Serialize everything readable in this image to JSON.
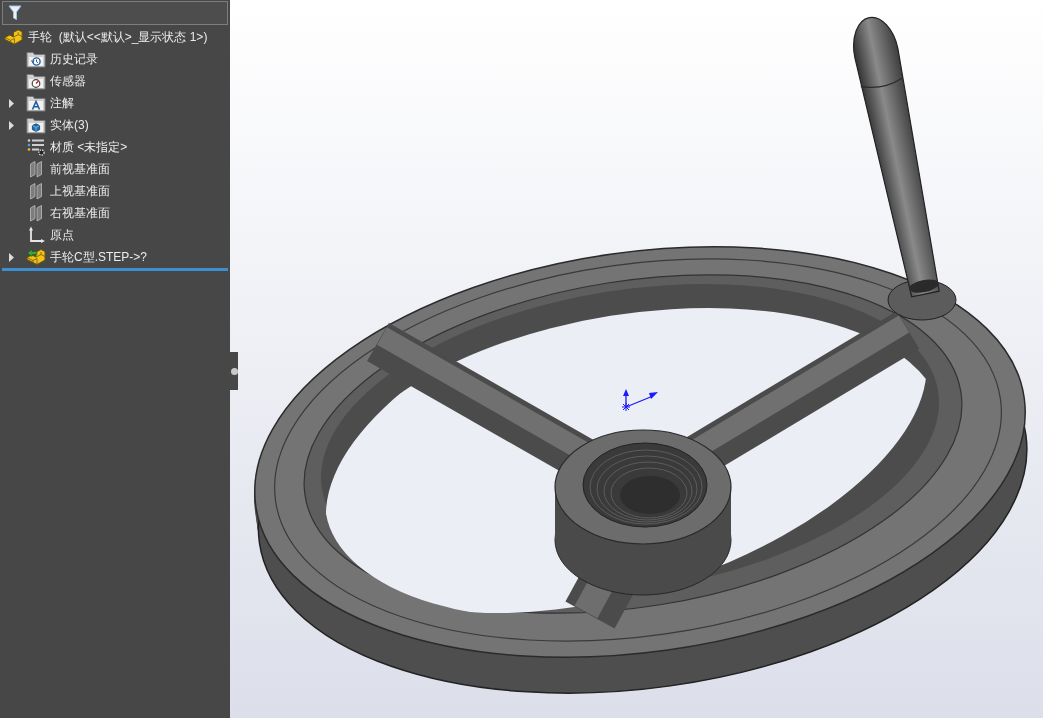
{
  "feature_tree": {
    "label": "手轮  (默认<<默认>_显示状态 1>)",
    "kind": "part",
    "selected": false,
    "children": [
      {
        "label": "历史记录",
        "kind": "history",
        "selected": false
      },
      {
        "label": "传感器",
        "kind": "sensor",
        "selected": false
      },
      {
        "label": "注解",
        "kind": "annotation",
        "selected": false,
        "expanded": false
      },
      {
        "label": "实体(3)",
        "kind": "bodies",
        "selected": false,
        "expanded": false
      },
      {
        "label": "材质 <未指定>",
        "kind": "material",
        "selected": false
      },
      {
        "label": "前视基准面",
        "kind": "plane",
        "selected": false
      },
      {
        "label": "上视基准面",
        "kind": "plane",
        "selected": false
      },
      {
        "label": "右视基准面",
        "kind": "plane",
        "selected": false
      },
      {
        "label": "原点",
        "kind": "origin",
        "selected": false
      },
      {
        "label": "手轮C型.STEP->?",
        "kind": "imported_part",
        "selected": false,
        "expanded": false
      }
    ]
  }
}
